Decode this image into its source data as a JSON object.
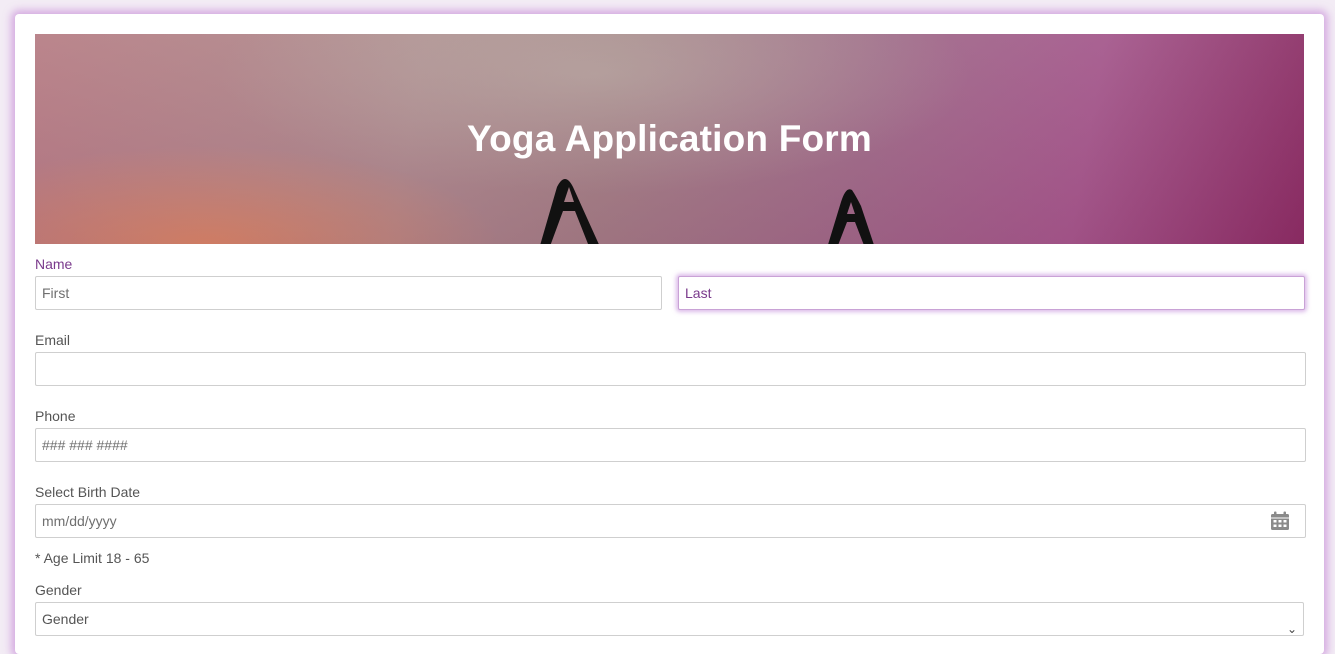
{
  "banner": {
    "title": "Yoga Application Form"
  },
  "form": {
    "name": {
      "label": "Name",
      "first_placeholder": "First",
      "last_placeholder": "Last"
    },
    "email": {
      "label": "Email",
      "value": ""
    },
    "phone": {
      "label": "Phone",
      "placeholder": "### ### ####"
    },
    "birth_date": {
      "label": "Select Birth Date",
      "placeholder": "mm/dd/yyyy",
      "icon": "calendar-icon",
      "hint": "* Age Limit 18 - 65"
    },
    "gender": {
      "label": "Gender",
      "selected": "Gender"
    }
  },
  "colors": {
    "accent": "#7a3a8c",
    "focus_glow": "#be82d7",
    "frame_glow": "#be78d2"
  }
}
